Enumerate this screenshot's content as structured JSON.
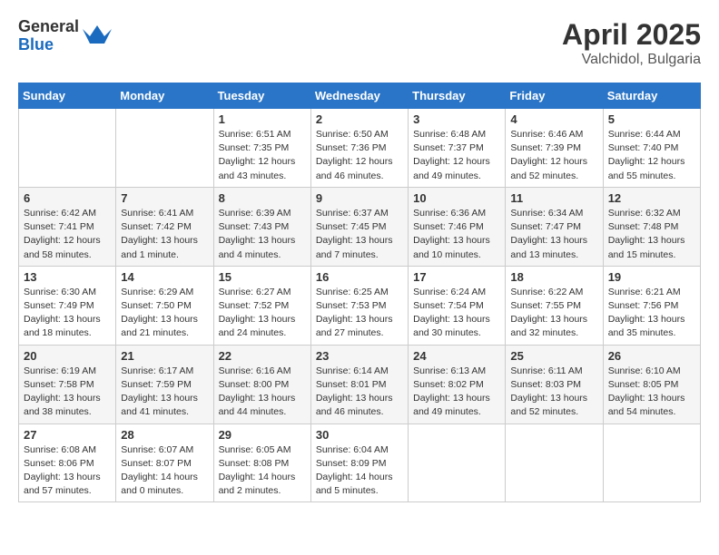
{
  "header": {
    "logo_general": "General",
    "logo_blue": "Blue",
    "month_title": "April 2025",
    "location": "Valchidol, Bulgaria"
  },
  "days_of_week": [
    "Sunday",
    "Monday",
    "Tuesday",
    "Wednesday",
    "Thursday",
    "Friday",
    "Saturday"
  ],
  "weeks": [
    [
      {
        "day": "",
        "sunrise": "",
        "sunset": "",
        "daylight": ""
      },
      {
        "day": "",
        "sunrise": "",
        "sunset": "",
        "daylight": ""
      },
      {
        "day": "1",
        "sunrise": "Sunrise: 6:51 AM",
        "sunset": "Sunset: 7:35 PM",
        "daylight": "Daylight: 12 hours and 43 minutes."
      },
      {
        "day": "2",
        "sunrise": "Sunrise: 6:50 AM",
        "sunset": "Sunset: 7:36 PM",
        "daylight": "Daylight: 12 hours and 46 minutes."
      },
      {
        "day": "3",
        "sunrise": "Sunrise: 6:48 AM",
        "sunset": "Sunset: 7:37 PM",
        "daylight": "Daylight: 12 hours and 49 minutes."
      },
      {
        "day": "4",
        "sunrise": "Sunrise: 6:46 AM",
        "sunset": "Sunset: 7:39 PM",
        "daylight": "Daylight: 12 hours and 52 minutes."
      },
      {
        "day": "5",
        "sunrise": "Sunrise: 6:44 AM",
        "sunset": "Sunset: 7:40 PM",
        "daylight": "Daylight: 12 hours and 55 minutes."
      }
    ],
    [
      {
        "day": "6",
        "sunrise": "Sunrise: 6:42 AM",
        "sunset": "Sunset: 7:41 PM",
        "daylight": "Daylight: 12 hours and 58 minutes."
      },
      {
        "day": "7",
        "sunrise": "Sunrise: 6:41 AM",
        "sunset": "Sunset: 7:42 PM",
        "daylight": "Daylight: 13 hours and 1 minute."
      },
      {
        "day": "8",
        "sunrise": "Sunrise: 6:39 AM",
        "sunset": "Sunset: 7:43 PM",
        "daylight": "Daylight: 13 hours and 4 minutes."
      },
      {
        "day": "9",
        "sunrise": "Sunrise: 6:37 AM",
        "sunset": "Sunset: 7:45 PM",
        "daylight": "Daylight: 13 hours and 7 minutes."
      },
      {
        "day": "10",
        "sunrise": "Sunrise: 6:36 AM",
        "sunset": "Sunset: 7:46 PM",
        "daylight": "Daylight: 13 hours and 10 minutes."
      },
      {
        "day": "11",
        "sunrise": "Sunrise: 6:34 AM",
        "sunset": "Sunset: 7:47 PM",
        "daylight": "Daylight: 13 hours and 13 minutes."
      },
      {
        "day": "12",
        "sunrise": "Sunrise: 6:32 AM",
        "sunset": "Sunset: 7:48 PM",
        "daylight": "Daylight: 13 hours and 15 minutes."
      }
    ],
    [
      {
        "day": "13",
        "sunrise": "Sunrise: 6:30 AM",
        "sunset": "Sunset: 7:49 PM",
        "daylight": "Daylight: 13 hours and 18 minutes."
      },
      {
        "day": "14",
        "sunrise": "Sunrise: 6:29 AM",
        "sunset": "Sunset: 7:50 PM",
        "daylight": "Daylight: 13 hours and 21 minutes."
      },
      {
        "day": "15",
        "sunrise": "Sunrise: 6:27 AM",
        "sunset": "Sunset: 7:52 PM",
        "daylight": "Daylight: 13 hours and 24 minutes."
      },
      {
        "day": "16",
        "sunrise": "Sunrise: 6:25 AM",
        "sunset": "Sunset: 7:53 PM",
        "daylight": "Daylight: 13 hours and 27 minutes."
      },
      {
        "day": "17",
        "sunrise": "Sunrise: 6:24 AM",
        "sunset": "Sunset: 7:54 PM",
        "daylight": "Daylight: 13 hours and 30 minutes."
      },
      {
        "day": "18",
        "sunrise": "Sunrise: 6:22 AM",
        "sunset": "Sunset: 7:55 PM",
        "daylight": "Daylight: 13 hours and 32 minutes."
      },
      {
        "day": "19",
        "sunrise": "Sunrise: 6:21 AM",
        "sunset": "Sunset: 7:56 PM",
        "daylight": "Daylight: 13 hours and 35 minutes."
      }
    ],
    [
      {
        "day": "20",
        "sunrise": "Sunrise: 6:19 AM",
        "sunset": "Sunset: 7:58 PM",
        "daylight": "Daylight: 13 hours and 38 minutes."
      },
      {
        "day": "21",
        "sunrise": "Sunrise: 6:17 AM",
        "sunset": "Sunset: 7:59 PM",
        "daylight": "Daylight: 13 hours and 41 minutes."
      },
      {
        "day": "22",
        "sunrise": "Sunrise: 6:16 AM",
        "sunset": "Sunset: 8:00 PM",
        "daylight": "Daylight: 13 hours and 44 minutes."
      },
      {
        "day": "23",
        "sunrise": "Sunrise: 6:14 AM",
        "sunset": "Sunset: 8:01 PM",
        "daylight": "Daylight: 13 hours and 46 minutes."
      },
      {
        "day": "24",
        "sunrise": "Sunrise: 6:13 AM",
        "sunset": "Sunset: 8:02 PM",
        "daylight": "Daylight: 13 hours and 49 minutes."
      },
      {
        "day": "25",
        "sunrise": "Sunrise: 6:11 AM",
        "sunset": "Sunset: 8:03 PM",
        "daylight": "Daylight: 13 hours and 52 minutes."
      },
      {
        "day": "26",
        "sunrise": "Sunrise: 6:10 AM",
        "sunset": "Sunset: 8:05 PM",
        "daylight": "Daylight: 13 hours and 54 minutes."
      }
    ],
    [
      {
        "day": "27",
        "sunrise": "Sunrise: 6:08 AM",
        "sunset": "Sunset: 8:06 PM",
        "daylight": "Daylight: 13 hours and 57 minutes."
      },
      {
        "day": "28",
        "sunrise": "Sunrise: 6:07 AM",
        "sunset": "Sunset: 8:07 PM",
        "daylight": "Daylight: 14 hours and 0 minutes."
      },
      {
        "day": "29",
        "sunrise": "Sunrise: 6:05 AM",
        "sunset": "Sunset: 8:08 PM",
        "daylight": "Daylight: 14 hours and 2 minutes."
      },
      {
        "day": "30",
        "sunrise": "Sunrise: 6:04 AM",
        "sunset": "Sunset: 8:09 PM",
        "daylight": "Daylight: 14 hours and 5 minutes."
      },
      {
        "day": "",
        "sunrise": "",
        "sunset": "",
        "daylight": ""
      },
      {
        "day": "",
        "sunrise": "",
        "sunset": "",
        "daylight": ""
      },
      {
        "day": "",
        "sunrise": "",
        "sunset": "",
        "daylight": ""
      }
    ]
  ]
}
